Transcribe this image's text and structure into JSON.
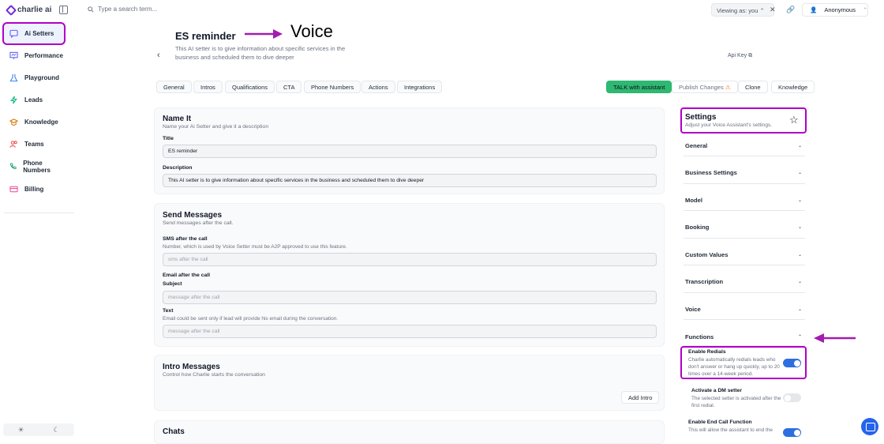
{
  "brand": {
    "name": "charlie ai"
  },
  "sidebar": {
    "items": [
      {
        "label": "Ai Setters",
        "active": true
      },
      {
        "label": "Performance"
      },
      {
        "label": "Playground"
      },
      {
        "label": "Leads"
      },
      {
        "label": "Knowledge"
      },
      {
        "label": "Teams"
      },
      {
        "label": "Phone Numbers"
      },
      {
        "label": "Billing"
      }
    ]
  },
  "topbar": {
    "search_placeholder": "Type a search term...",
    "viewing_as": "Viewing as: you",
    "user": "Anonymous"
  },
  "header": {
    "title": "ES reminder",
    "annotation": "Voice",
    "description": "This AI setter is to give information about specific services in the business and scheduled them to dive deeper",
    "api_key": "Api Key"
  },
  "tabs": [
    "General",
    "Intros",
    "Qualifications",
    "CTA",
    "Phone Numbers",
    "Actions",
    "Integrations"
  ],
  "actions": {
    "talk": "TALK with assistant",
    "publish": "Publish Changes",
    "clone": "Clone",
    "knowledge": "Knowledge"
  },
  "name_it": {
    "title": "Name It",
    "subtitle": "Name your Ai Setter and give it a description",
    "title_label": "Title",
    "title_value": "ES reminder",
    "description_label": "Description",
    "description_value": "This AI setter is to give information about specific services in the business and scheduled them to dive deeper"
  },
  "send_messages": {
    "title": "Send Messages",
    "subtitle": "Send messages after the call.",
    "sms_label": "SMS after the call",
    "sms_help": "Number, which is used by Voice Setter must be A2P approved to use this feature.",
    "sms_placeholder": "sms after the call",
    "email_label": "Email after the call",
    "subject_label": "Subject",
    "subject_placeholder": "message after the call",
    "text_label": "Text",
    "text_help": "Email could be sent only if lead will provide his email during the conversation.",
    "text_placeholder": "message after the call"
  },
  "intro_messages": {
    "title": "Intro Messages",
    "subtitle": "Control how Charlie starts the conversation",
    "add_intro": "Add Intro"
  },
  "chats": {
    "title": "Chats"
  },
  "settings": {
    "title": "Settings",
    "subtitle": "Adjust your Voice Assistant's settings.",
    "sections": [
      "General",
      "Business Settings",
      "Model",
      "Booking",
      "Custom Values",
      "Transcription",
      "Voice",
      "Functions"
    ],
    "functions": [
      {
        "title": "Enable Redials",
        "desc": "Charlie automatically redials leads who don't answer or hang up quickly, up to 20 times over a 14-week period.",
        "enabled": true
      },
      {
        "title": "Activate a DM setter",
        "desc": "The selected setter is activated after the first redial.",
        "enabled": false
      },
      {
        "title": "Enable End Call Function",
        "desc": "This will allow the assistant to end the",
        "enabled": true
      }
    ]
  },
  "colors": {
    "accent_green": "#2eb872",
    "highlight": "#b000c8",
    "toggle_on": "#2d6fe0"
  }
}
